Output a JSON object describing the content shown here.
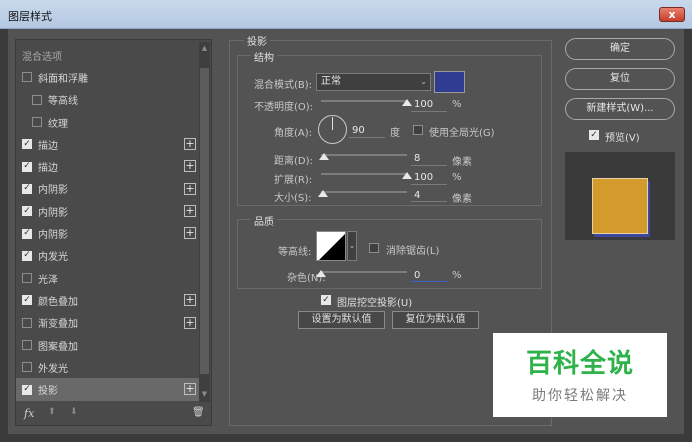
{
  "window": {
    "title": "图层样式",
    "close_glyph": "x"
  },
  "styles_list": {
    "items": [
      {
        "label": "混合选项",
        "type": "header",
        "checked": false,
        "plus": false
      },
      {
        "label": "斜面和浮雕",
        "type": "item",
        "checked": false,
        "plus": false
      },
      {
        "label": "等高线",
        "type": "sub",
        "checked": false,
        "plus": false
      },
      {
        "label": "纹理",
        "type": "sub",
        "checked": false,
        "plus": false
      },
      {
        "label": "描边",
        "type": "item",
        "checked": true,
        "plus": true
      },
      {
        "label": "描边",
        "type": "item",
        "checked": true,
        "plus": true
      },
      {
        "label": "内阴影",
        "type": "item",
        "checked": true,
        "plus": true
      },
      {
        "label": "内阴影",
        "type": "item",
        "checked": true,
        "plus": true
      },
      {
        "label": "内阴影",
        "type": "item",
        "checked": true,
        "plus": true
      },
      {
        "label": "内发光",
        "type": "item",
        "checked": true,
        "plus": false
      },
      {
        "label": "光泽",
        "type": "item",
        "checked": false,
        "plus": false
      },
      {
        "label": "颜色叠加",
        "type": "item",
        "checked": true,
        "plus": true
      },
      {
        "label": "渐变叠加",
        "type": "item",
        "checked": false,
        "plus": true
      },
      {
        "label": "图案叠加",
        "type": "item",
        "checked": false,
        "plus": false
      },
      {
        "label": "外发光",
        "type": "item",
        "checked": false,
        "plus": false
      },
      {
        "label": "投影",
        "type": "item",
        "checked": true,
        "plus": true,
        "selected": true
      }
    ],
    "footer": {
      "fx": "fx",
      "up_icon": "⬆",
      "down_icon": "⬇",
      "trash_icon": "🗑"
    }
  },
  "drop_shadow": {
    "section_title": "投影",
    "structure": {
      "title": "结构",
      "blend_mode_label": "混合模式(B):",
      "blend_mode_value": "正常",
      "shadow_color": "#2f3c91",
      "opacity_label": "不透明度(O):",
      "opacity_value": "100",
      "opacity_unit": "%",
      "opacity_fraction": 1.0,
      "angle_label": "角度(A):",
      "angle_value": "90",
      "angle_unit": "度",
      "global_light_label": "使用全局光(G)",
      "distance_label": "距离(D):",
      "distance_value": "8",
      "distance_unit": "像素",
      "distance_fraction": 0.03,
      "spread_label": "扩展(R):",
      "spread_value": "100",
      "spread_unit": "%",
      "spread_fraction": 1.0,
      "size_label": "大小(S):",
      "size_value": "4",
      "size_unit": "像素",
      "size_fraction": 0.02
    },
    "quality": {
      "title": "品质",
      "contour_label": "等高线:",
      "anti_alias_label": "消除锯齿(L)",
      "noise_label": "杂色(N):",
      "noise_value": "0",
      "noise_unit": "%",
      "noise_fraction": 0.0
    },
    "knockout_label": "图层挖空投影(U)",
    "make_default_label": "设置为默认值",
    "reset_default_label": "复位为默认值"
  },
  "buttons": {
    "ok": "确定",
    "reset": "复位",
    "new_style": "新建样式(W)...",
    "preview_label": "预览(V)"
  },
  "watermark": {
    "big": "百科全说",
    "small": "助你轻松解决"
  },
  "colors": {
    "accent_preview": "#d29b2c",
    "shadow": "#2f3c91",
    "watermark_green": "#2fb24a"
  }
}
